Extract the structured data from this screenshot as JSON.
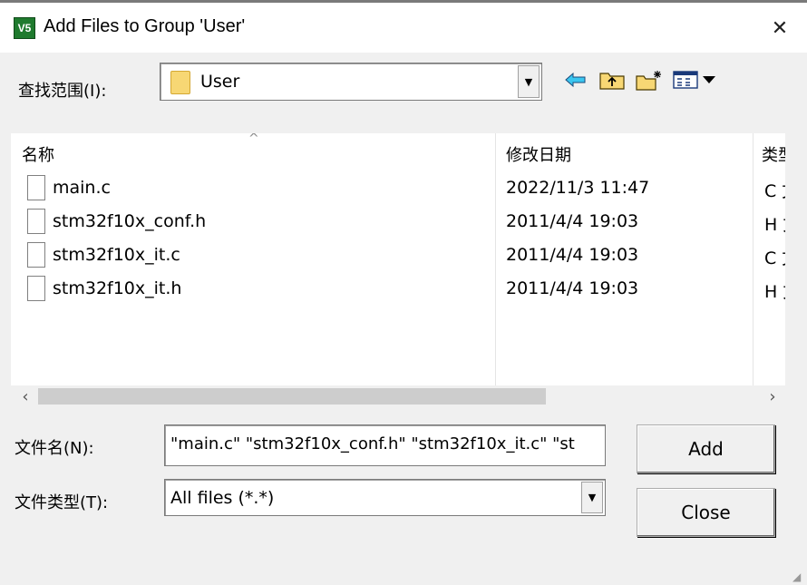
{
  "window": {
    "title": "Add Files to Group 'User'",
    "app_icon_text": "V5",
    "close_glyph": "✕"
  },
  "lookin": {
    "label": "查找范围(I):",
    "value": "User"
  },
  "toolbar": {
    "icons": [
      "back-icon",
      "up-folder-icon",
      "new-folder-icon",
      "view-menu-icon"
    ]
  },
  "list": {
    "headers": {
      "name": "名称",
      "date": "修改日期",
      "type": "类型"
    },
    "files": [
      {
        "name": "main.c",
        "date": "2022/11/3 11:47",
        "type": "C 文件"
      },
      {
        "name": "stm32f10x_conf.h",
        "date": "2011/4/4 19:03",
        "type": "H 文件"
      },
      {
        "name": "stm32f10x_it.c",
        "date": "2011/4/4 19:03",
        "type": "C 文件"
      },
      {
        "name": "stm32f10x_it.h",
        "date": "2011/4/4 19:03",
        "type": "H 文件"
      }
    ]
  },
  "filename": {
    "label": "文件名(N):",
    "value": "\"main.c\" \"stm32f10x_conf.h\" \"stm32f10x_it.c\" \"st"
  },
  "filetype": {
    "label": "文件类型(T):",
    "value": "All files (*.*)"
  },
  "buttons": {
    "add": "Add",
    "close": "Close"
  }
}
